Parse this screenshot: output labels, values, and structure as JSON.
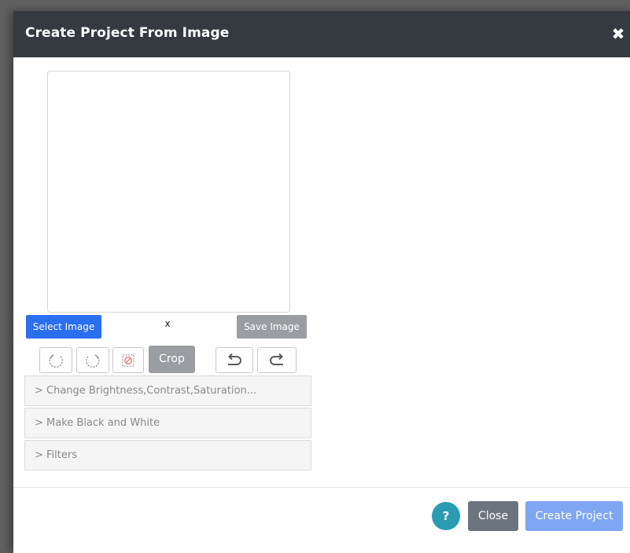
{
  "dialog": {
    "title": "Create Project From Image",
    "close_icon": "close-icon"
  },
  "image_panel": {
    "select_label": "Select Image",
    "dimension_text": "x",
    "save_label": "Save Image"
  },
  "toolbar": {
    "rotate_left_icon": "rotate-left-icon",
    "rotate_right_icon": "rotate-right-icon",
    "clear_selection_icon": "clear-selection-icon",
    "crop_label": "Crop",
    "undo_icon": "undo-icon",
    "redo_icon": "redo-icon"
  },
  "sections": [
    {
      "label": "> Change Brightness,Contrast,Saturation..."
    },
    {
      "label": "> Make Black and White"
    },
    {
      "label": "> Filters"
    }
  ],
  "footer": {
    "help_label": "?",
    "close_label": "Close",
    "create_label": "Create Project"
  },
  "colors": {
    "header_bg": "#343a40",
    "primary": "#2a6ff0",
    "primary_disabled": "#7ea6f3",
    "secondary": "#6c757d",
    "info": "#2a9bb0",
    "muted_button": "#9a9ea2"
  }
}
